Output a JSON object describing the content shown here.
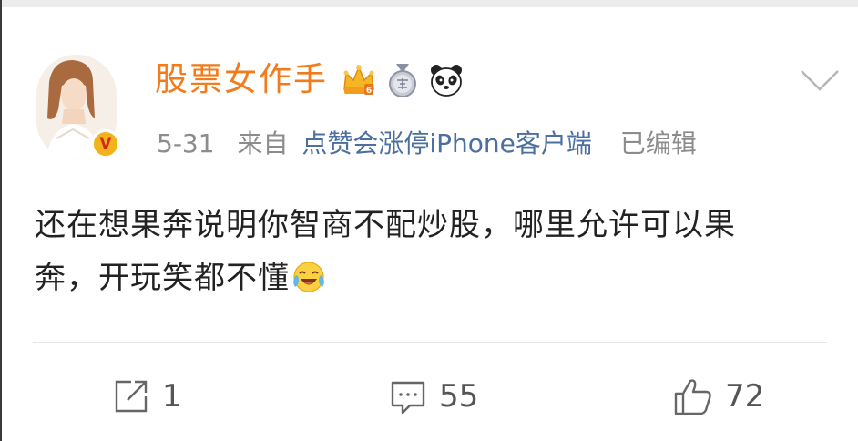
{
  "post": {
    "author": {
      "name": "股票女作手",
      "verified_mark": "V",
      "badges": [
        "crown-vip-icon",
        "medal-icon",
        "panda-icon"
      ]
    },
    "meta": {
      "time": "5-31",
      "source_prefix": "来自",
      "source": "点赞会涨停iPhone客户端",
      "edited": "已编辑"
    },
    "content": {
      "line1": "还在想果奔说明你智商不配炒股，哪里允许可以果",
      "line2": "奔，开玩笑都不懂",
      "emoji": "laugh-cry-emoji"
    }
  },
  "actions": {
    "repost_count": "1",
    "comment_count": "55",
    "like_count": "72"
  },
  "colors": {
    "username": "#f27b1b",
    "source_link": "#4b6f9e",
    "meta_text": "#8c8c8c",
    "body_text": "#222222"
  }
}
